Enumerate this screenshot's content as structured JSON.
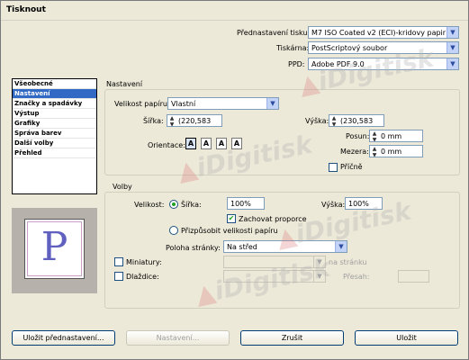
{
  "window": {
    "title": "Tisknout"
  },
  "header": {
    "preset_label": "Přednastavení tisku:",
    "preset_value": "M7 ISO Coated v2 (ECI)-kridovy papir",
    "printer_label": "Tiskárna:",
    "printer_value": "PostScriptový soubor",
    "ppd_label": "PPD:",
    "ppd_value": "Adobe PDF 9.0"
  },
  "sidebar": {
    "items": [
      {
        "label": "Všeobecné",
        "selected": false
      },
      {
        "label": "Nastavení",
        "selected": true
      },
      {
        "label": "Značky a spadávky",
        "selected": false
      },
      {
        "label": "Výstup",
        "selected": false
      },
      {
        "label": "Grafiky",
        "selected": false
      },
      {
        "label": "Správa barev",
        "selected": false
      },
      {
        "label": "Další volby",
        "selected": false
      },
      {
        "label": "Přehled",
        "selected": false
      }
    ]
  },
  "preview": {
    "letter": "P"
  },
  "nastaveni": {
    "title": "Nastavení",
    "paper_size_label": "Velikost papíru:",
    "paper_size_value": "Vlastní",
    "width_label": "Šířka:",
    "width_value": "(220,583",
    "height_label": "Výška:",
    "height_value": "(230,583",
    "offset_label": "Posun:",
    "offset_value": "0 mm",
    "gap_label": "Mezera:",
    "gap_value": "0 mm",
    "transverse_label": "Příčně",
    "orientation_label": "Orientace:"
  },
  "volby": {
    "title": "Volby",
    "size_label": "Velikost:",
    "width_radio_label": "Šířka:",
    "width_value": "100%",
    "height_label": "Výška:",
    "height_value": "100%",
    "keep_proportions_label": "Zachovat proporce",
    "fit_label": "Přizpůsobit velikosti papíru",
    "page_position_label": "Poloha stránky:",
    "page_position_value": "Na střed",
    "thumbnails_label": "Miniatury:",
    "thumbnails_right": "na stránku",
    "tiles_label": "Dlaždice:",
    "overlap_label": "Přesah:"
  },
  "buttons": {
    "save_preset": "Uložit přednastavení...",
    "setup": "Nastavení...",
    "cancel": "Zrušit",
    "save": "Uložit"
  },
  "watermark": {
    "text": "iDigitisk"
  }
}
